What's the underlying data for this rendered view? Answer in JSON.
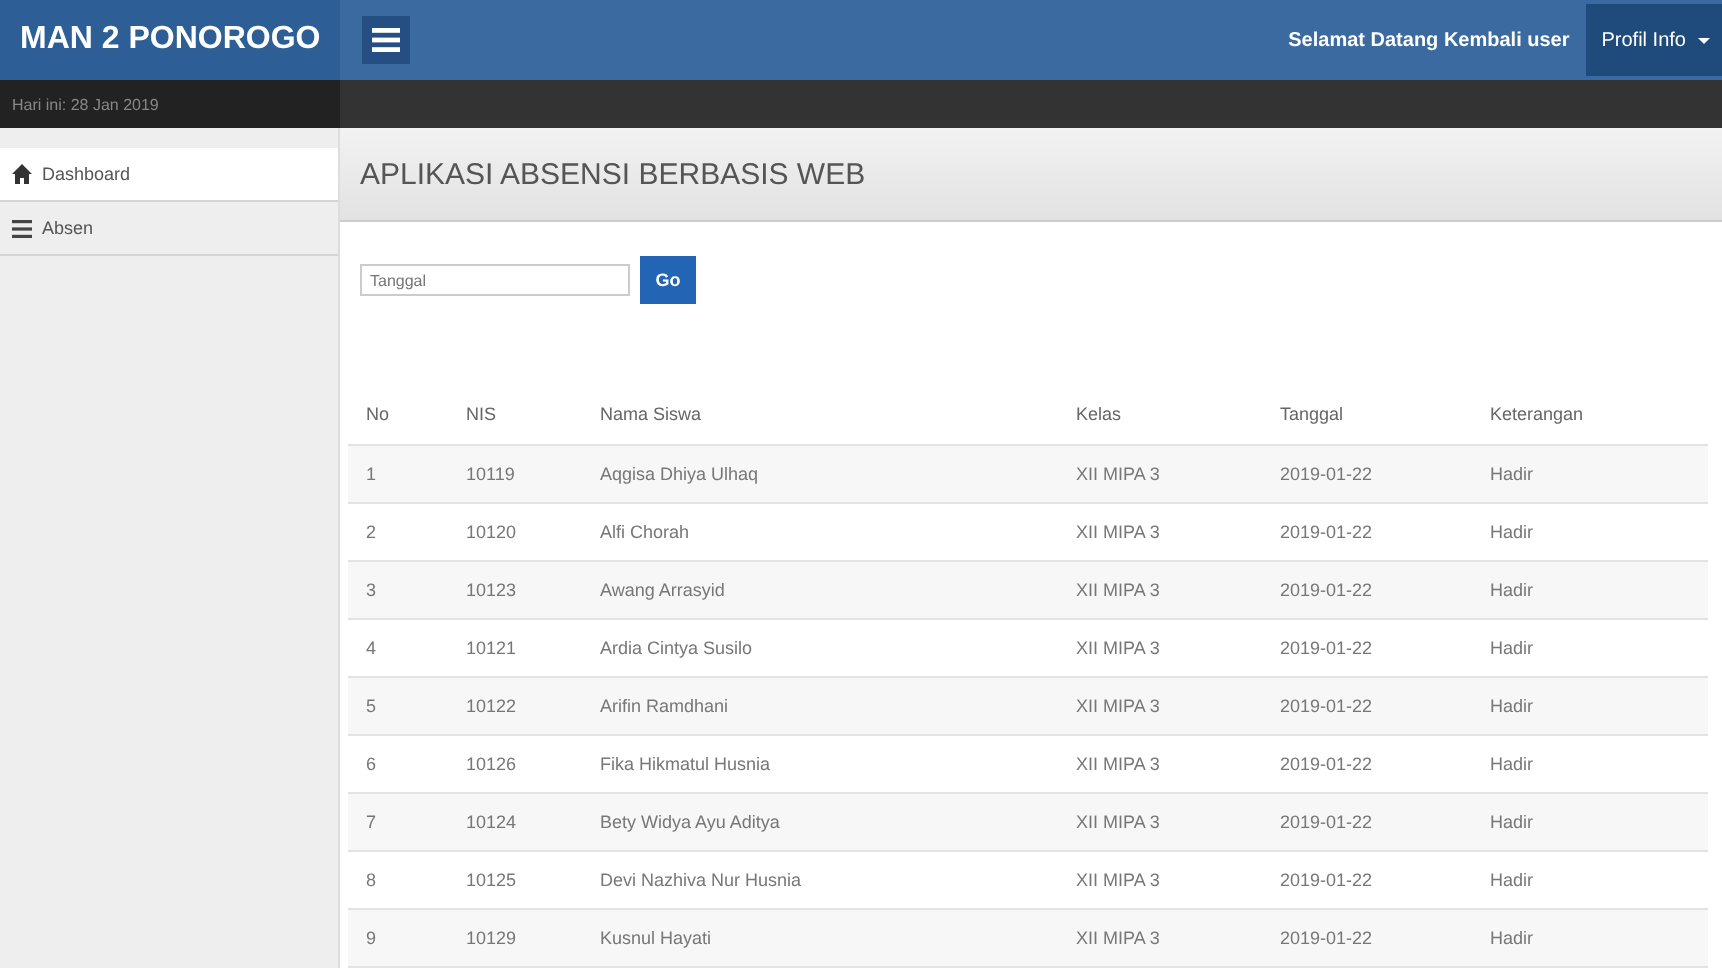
{
  "brand": "MAN 2 PONOROGO",
  "topbar": {
    "welcome": "Selamat Datang Kembali user",
    "profile_menu": "Profil Info"
  },
  "date_line": "Hari ini: 28 Jan 2019",
  "sidebar": {
    "items": [
      {
        "label": "Dashboard",
        "selected": true
      },
      {
        "label": "Absen",
        "selected": false
      }
    ]
  },
  "page_title": "APLIKASI ABSENSI BERBASIS WEB",
  "filter": {
    "placeholder": "Tanggal",
    "button": "Go"
  },
  "table": {
    "columns": [
      "No",
      "NIS",
      "Nama Siswa",
      "Kelas",
      "Tanggal",
      "Keterangan"
    ],
    "rows": [
      [
        "1",
        "10119",
        "Aqgisa Dhiya Ulhaq",
        "XII MIPA 3",
        "2019-01-22",
        "Hadir"
      ],
      [
        "2",
        "10120",
        "Alfi Chorah",
        "XII MIPA 3",
        "2019-01-22",
        "Hadir"
      ],
      [
        "3",
        "10123",
        "Awang Arrasyid",
        "XII MIPA 3",
        "2019-01-22",
        "Hadir"
      ],
      [
        "4",
        "10121",
        "Ardia Cintya Susilo",
        "XII MIPA 3",
        "2019-01-22",
        "Hadir"
      ],
      [
        "5",
        "10122",
        "Arifin Ramdhani",
        "XII MIPA 3",
        "2019-01-22",
        "Hadir"
      ],
      [
        "6",
        "10126",
        "Fika Hikmatul Husnia",
        "XII MIPA 3",
        "2019-01-22",
        "Hadir"
      ],
      [
        "7",
        "10124",
        "Bety Widya Ayu Aditya",
        "XII MIPA 3",
        "2019-01-22",
        "Hadir"
      ],
      [
        "8",
        "10125",
        "Devi Nazhiva Nur Husnia",
        "XII MIPA 3",
        "2019-01-22",
        "Hadir"
      ],
      [
        "9",
        "10129",
        "Kusnul Hayati",
        "XII MIPA 3",
        "2019-01-22",
        "Hadir"
      ]
    ]
  }
}
